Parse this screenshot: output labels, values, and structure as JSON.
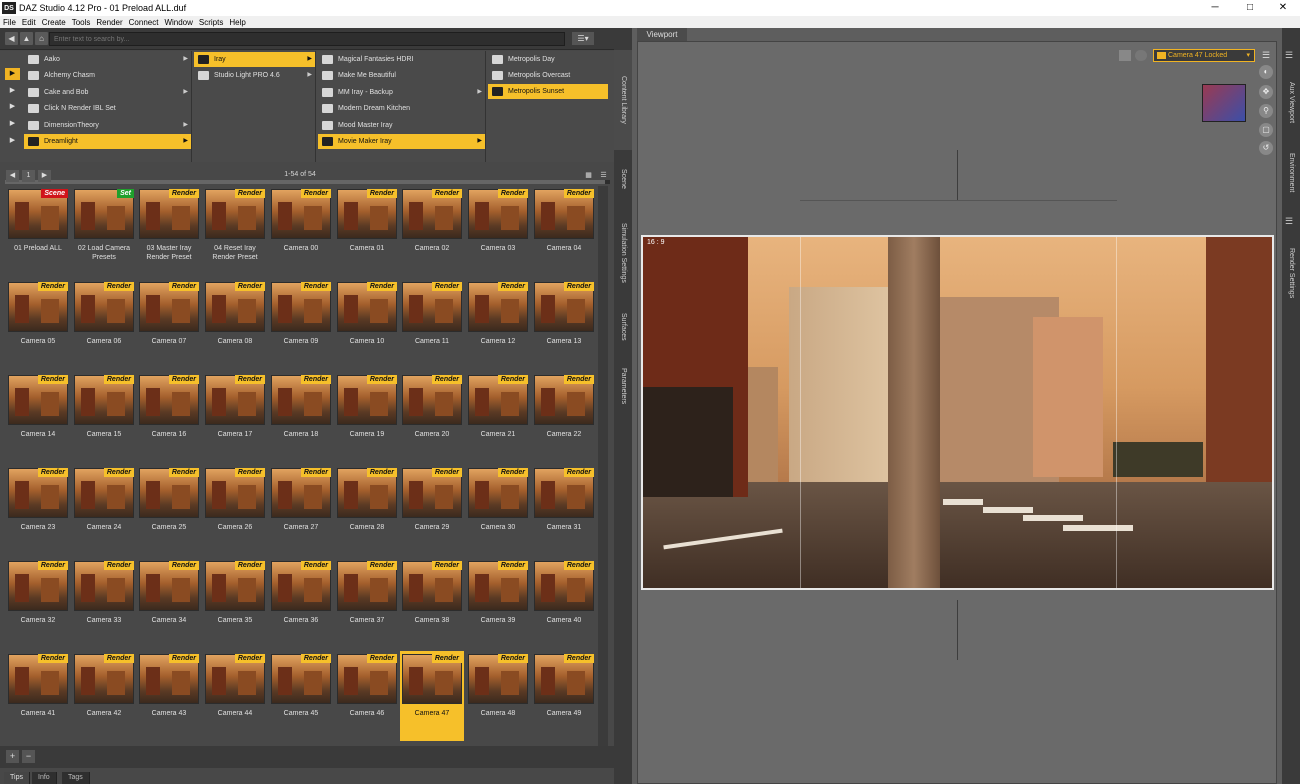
{
  "window": {
    "title": "DAZ Studio 4.12 Pro - 01 Preload ALL.duf",
    "logo": "DS",
    "minimize_icon": "─",
    "maximize_icon": "□",
    "close_icon": "✕"
  },
  "menu": [
    "File",
    "Edit",
    "Create",
    "Tools",
    "Render",
    "Connect",
    "Window",
    "Scripts",
    "Help"
  ],
  "search": {
    "placeholder": "Enter text to search by..."
  },
  "icons": {
    "back": "◀",
    "up": "▲",
    "home": "⌂",
    "view_options": "☰▾",
    "add": "+",
    "remove": "−",
    "grid_view": "▦",
    "list_view": "☰",
    "page_first": "◀",
    "page_next": "▶"
  },
  "browser": {
    "col1": [
      {
        "label": "Aako",
        "arrow": "▶"
      },
      {
        "label": "Alchemy Chasm",
        "arrow": ""
      },
      {
        "label": "Cake and Bob",
        "arrow": "▶"
      },
      {
        "label": "Click N Render IBL Set",
        "arrow": ""
      },
      {
        "label": "DimensionTheory",
        "arrow": "▶"
      },
      {
        "label": "Dreamlight",
        "arrow": "▶",
        "selected": true
      }
    ],
    "col2": [
      {
        "label": "Iray",
        "arrow": "▶",
        "selected": true
      },
      {
        "label": "Studio Light PRO 4.6",
        "arrow": "▶"
      }
    ],
    "col3": [
      {
        "label": "Magical Fantasies HDRI",
        "arrow": ""
      },
      {
        "label": "Make Me Beautiful",
        "arrow": ""
      },
      {
        "label": "MM Iray - Backup",
        "arrow": "▶"
      },
      {
        "label": "Modern Dream Kitchen",
        "arrow": ""
      },
      {
        "label": "Mood Master Iray",
        "arrow": ""
      },
      {
        "label": "Movie Maker Iray",
        "arrow": "▶",
        "selected": true
      }
    ],
    "col4": [
      {
        "label": "Metropolis Day",
        "arrow": ""
      },
      {
        "label": "Metropolis Overcast",
        "arrow": ""
      },
      {
        "label": "Metropolis Sunset",
        "arrow": "",
        "selected": true
      }
    ]
  },
  "pager": {
    "page": "1",
    "info": "1-54 of 54"
  },
  "tiles": [
    {
      "label": "01 Preload ALL",
      "badge": "Scene"
    },
    {
      "label": "02 Load Camera Presets",
      "badge": "Set"
    },
    {
      "label": "03 Master Iray Render Preset",
      "badge": "Render"
    },
    {
      "label": "04 Reset Iray Render Preset",
      "badge": "Render"
    },
    {
      "label": "Camera 00",
      "badge": "Render"
    },
    {
      "label": "Camera 01",
      "badge": "Render"
    },
    {
      "label": "Camera 02",
      "badge": "Render"
    },
    {
      "label": "Camera 03",
      "badge": "Render"
    },
    {
      "label": "Camera 04",
      "badge": "Render"
    },
    {
      "label": "Camera 05",
      "badge": "Render"
    },
    {
      "label": "Camera 06",
      "badge": "Render"
    },
    {
      "label": "Camera 07",
      "badge": "Render"
    },
    {
      "label": "Camera 08",
      "badge": "Render"
    },
    {
      "label": "Camera 09",
      "badge": "Render"
    },
    {
      "label": "Camera 10",
      "badge": "Render"
    },
    {
      "label": "Camera 11",
      "badge": "Render"
    },
    {
      "label": "Camera 12",
      "badge": "Render"
    },
    {
      "label": "Camera 13",
      "badge": "Render"
    },
    {
      "label": "Camera 14",
      "badge": "Render"
    },
    {
      "label": "Camera 15",
      "badge": "Render"
    },
    {
      "label": "Camera 16",
      "badge": "Render"
    },
    {
      "label": "Camera 17",
      "badge": "Render"
    },
    {
      "label": "Camera 18",
      "badge": "Render"
    },
    {
      "label": "Camera 19",
      "badge": "Render"
    },
    {
      "label": "Camera 20",
      "badge": "Render"
    },
    {
      "label": "Camera 21",
      "badge": "Render"
    },
    {
      "label": "Camera 22",
      "badge": "Render"
    },
    {
      "label": "Camera 23",
      "badge": "Render"
    },
    {
      "label": "Camera 24",
      "badge": "Render"
    },
    {
      "label": "Camera 25",
      "badge": "Render"
    },
    {
      "label": "Camera 26",
      "badge": "Render"
    },
    {
      "label": "Camera 27",
      "badge": "Render"
    },
    {
      "label": "Camera 28",
      "badge": "Render"
    },
    {
      "label": "Camera 29",
      "badge": "Render"
    },
    {
      "label": "Camera 30",
      "badge": "Render"
    },
    {
      "label": "Camera 31",
      "badge": "Render"
    },
    {
      "label": "Camera 32",
      "badge": "Render"
    },
    {
      "label": "Camera 33",
      "badge": "Render"
    },
    {
      "label": "Camera 34",
      "badge": "Render"
    },
    {
      "label": "Camera 35",
      "badge": "Render"
    },
    {
      "label": "Camera 36",
      "badge": "Render"
    },
    {
      "label": "Camera 37",
      "badge": "Render"
    },
    {
      "label": "Camera 38",
      "badge": "Render"
    },
    {
      "label": "Camera 39",
      "badge": "Render"
    },
    {
      "label": "Camera 40",
      "badge": "Render"
    },
    {
      "label": "Camera 41",
      "badge": "Render"
    },
    {
      "label": "Camera 42",
      "badge": "Render"
    },
    {
      "label": "Camera 43",
      "badge": "Render"
    },
    {
      "label": "Camera 44",
      "badge": "Render"
    },
    {
      "label": "Camera 45",
      "badge": "Render"
    },
    {
      "label": "Camera 46",
      "badge": "Render"
    },
    {
      "label": "Camera 47",
      "badge": "Render",
      "selected": true
    },
    {
      "label": "Camera 48",
      "badge": "Render"
    },
    {
      "label": "Camera 49",
      "badge": "Render"
    }
  ],
  "bottom_tabs": [
    "Tips",
    "Info",
    "Tags"
  ],
  "left_side_tabs": [
    "Content Library",
    "Scene",
    "Simulation Settings",
    "Surfaces",
    "Parameters"
  ],
  "right_side_tabs": [
    "Aux Viewport",
    "Environment",
    "Render Settings"
  ],
  "viewport": {
    "tab": "Viewport",
    "camera": "Camera 47 Locked",
    "aspect": "16 : 9"
  },
  "colors": {
    "accent": "#f6c02a",
    "scene_badge": "#d0141a",
    "set_badge": "#1fa02b"
  }
}
